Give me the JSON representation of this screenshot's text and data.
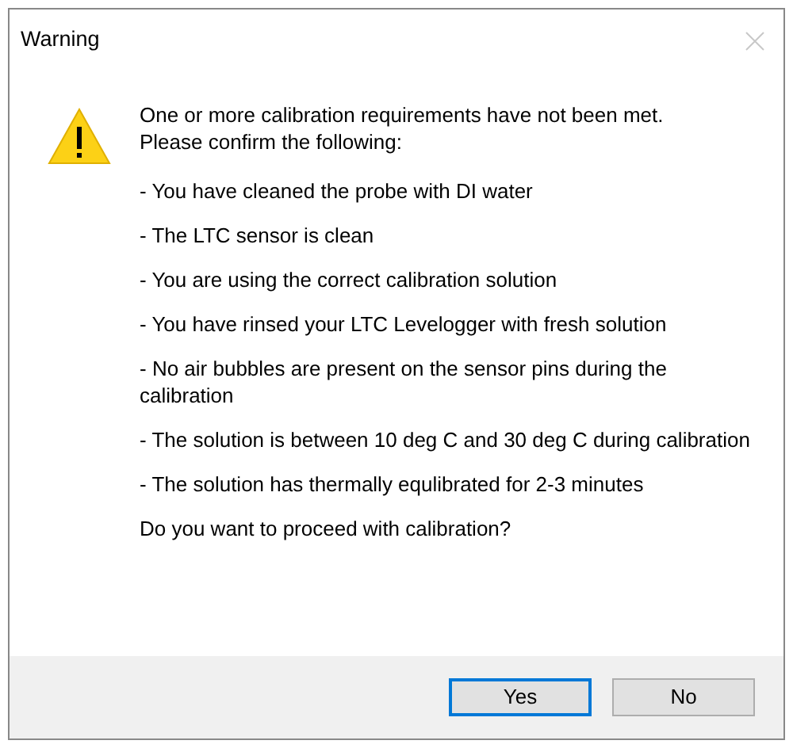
{
  "window": {
    "title": "Warning"
  },
  "message": {
    "intro_lines": [
      "One or more calibration requirements have not been met.",
      "Please confirm the following:"
    ],
    "items": [
      "- You have cleaned the probe with DI water",
      "- The LTC sensor is clean",
      "- You are using the correct calibration solution",
      "- You have rinsed your LTC Levelogger with fresh solution",
      "- No air bubbles are present on the sensor pins during the calibration",
      "- The solution is between 10 deg C and 30 deg C during calibration",
      "- The solution has thermally equlibrated for 2-3 minutes"
    ],
    "question": "Do you want to proceed with calibration?"
  },
  "buttons": [
    {
      "label": "Yes",
      "default": true
    },
    {
      "label": "No",
      "default": false
    }
  ]
}
